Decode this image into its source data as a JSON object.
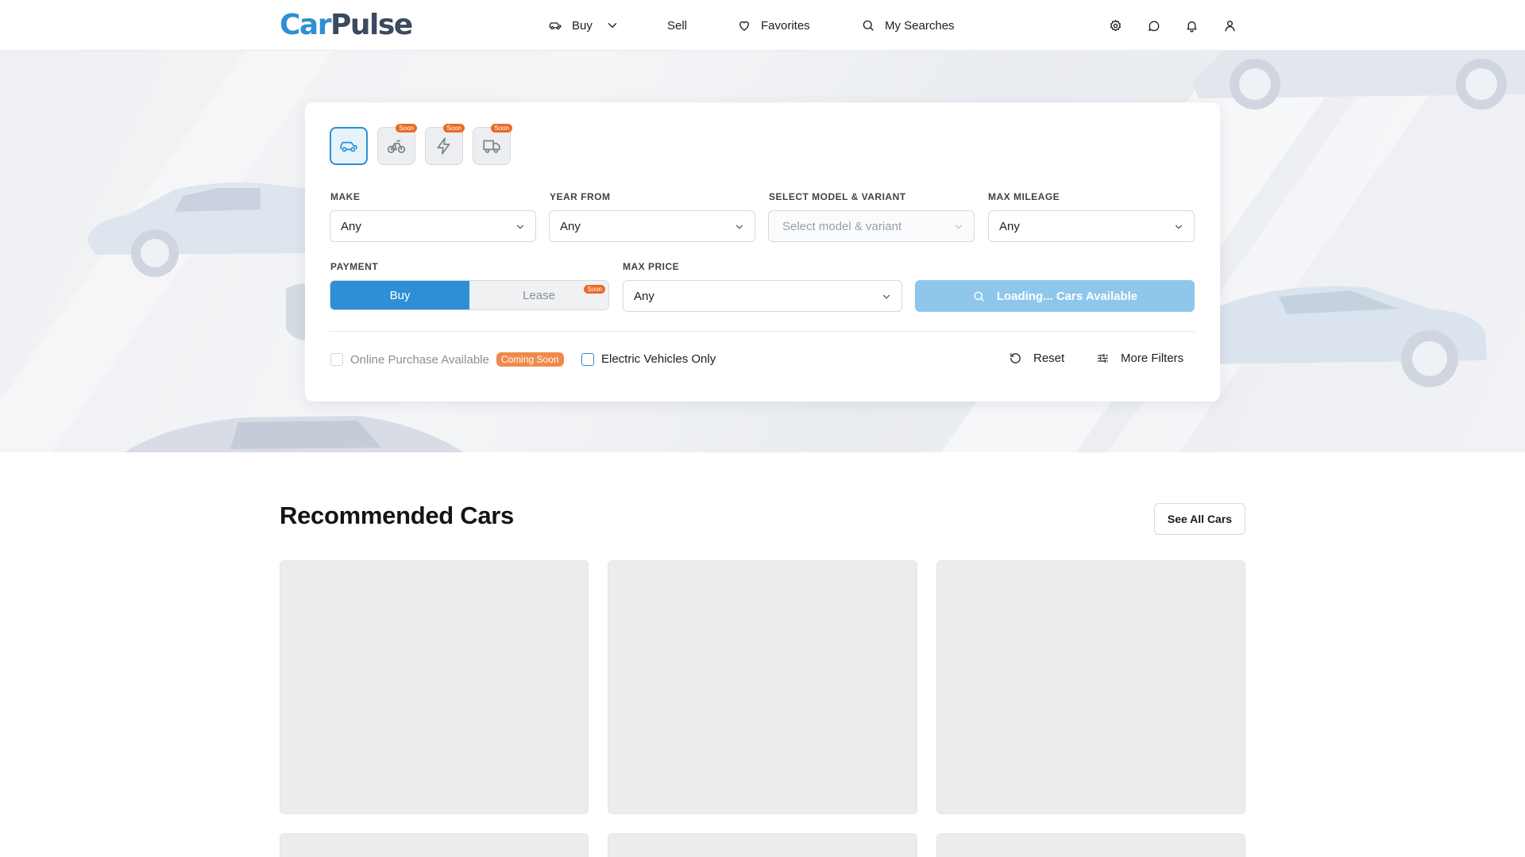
{
  "brand": {
    "part1": "Car",
    "part2": "Pulse"
  },
  "nav": {
    "buy": "Buy",
    "sell": "Sell",
    "favorites": "Favorites",
    "my_searches": "My Searches"
  },
  "header_icons": [
    "settings-icon",
    "chat-icon",
    "bell-icon",
    "user-icon"
  ],
  "vehicle_types": [
    {
      "icon": "car-icon",
      "active": true,
      "badge": ""
    },
    {
      "icon": "bicycle-icon",
      "active": false,
      "badge": "Soon"
    },
    {
      "icon": "lightning-icon",
      "active": false,
      "badge": "Soon"
    },
    {
      "icon": "truck-icon",
      "active": false,
      "badge": "Soon"
    }
  ],
  "filters": {
    "make": {
      "label": "MAKE",
      "value": "Any"
    },
    "year_from": {
      "label": "YEAR FROM",
      "value": "Any"
    },
    "model": {
      "label": "SELECT MODEL & VARIANT",
      "placeholder": "Select model & variant"
    },
    "max_mileage": {
      "label": "MAX MILEAGE",
      "value": "Any"
    },
    "payment": {
      "label": "PAYMENT",
      "buy": "Buy",
      "lease": "Lease",
      "lease_badge": "Soon"
    },
    "max_price": {
      "label": "MAX PRICE",
      "value": "Any"
    }
  },
  "search_button": "Loading... Cars Available",
  "options": {
    "online_purchase": "Online Purchase Available",
    "coming_soon": "Coming Soon",
    "electric_only": "Electric Vehicles Only",
    "reset": "Reset",
    "more_filters": "More Filters"
  },
  "recommended": {
    "title": "Recommended Cars",
    "see_all": "See All Cars"
  },
  "colors": {
    "accent": "#2d8fd5",
    "accent_muted": "#8ec6ec",
    "badge_orange": "#ea6a25",
    "skeleton": "#ebecee"
  }
}
